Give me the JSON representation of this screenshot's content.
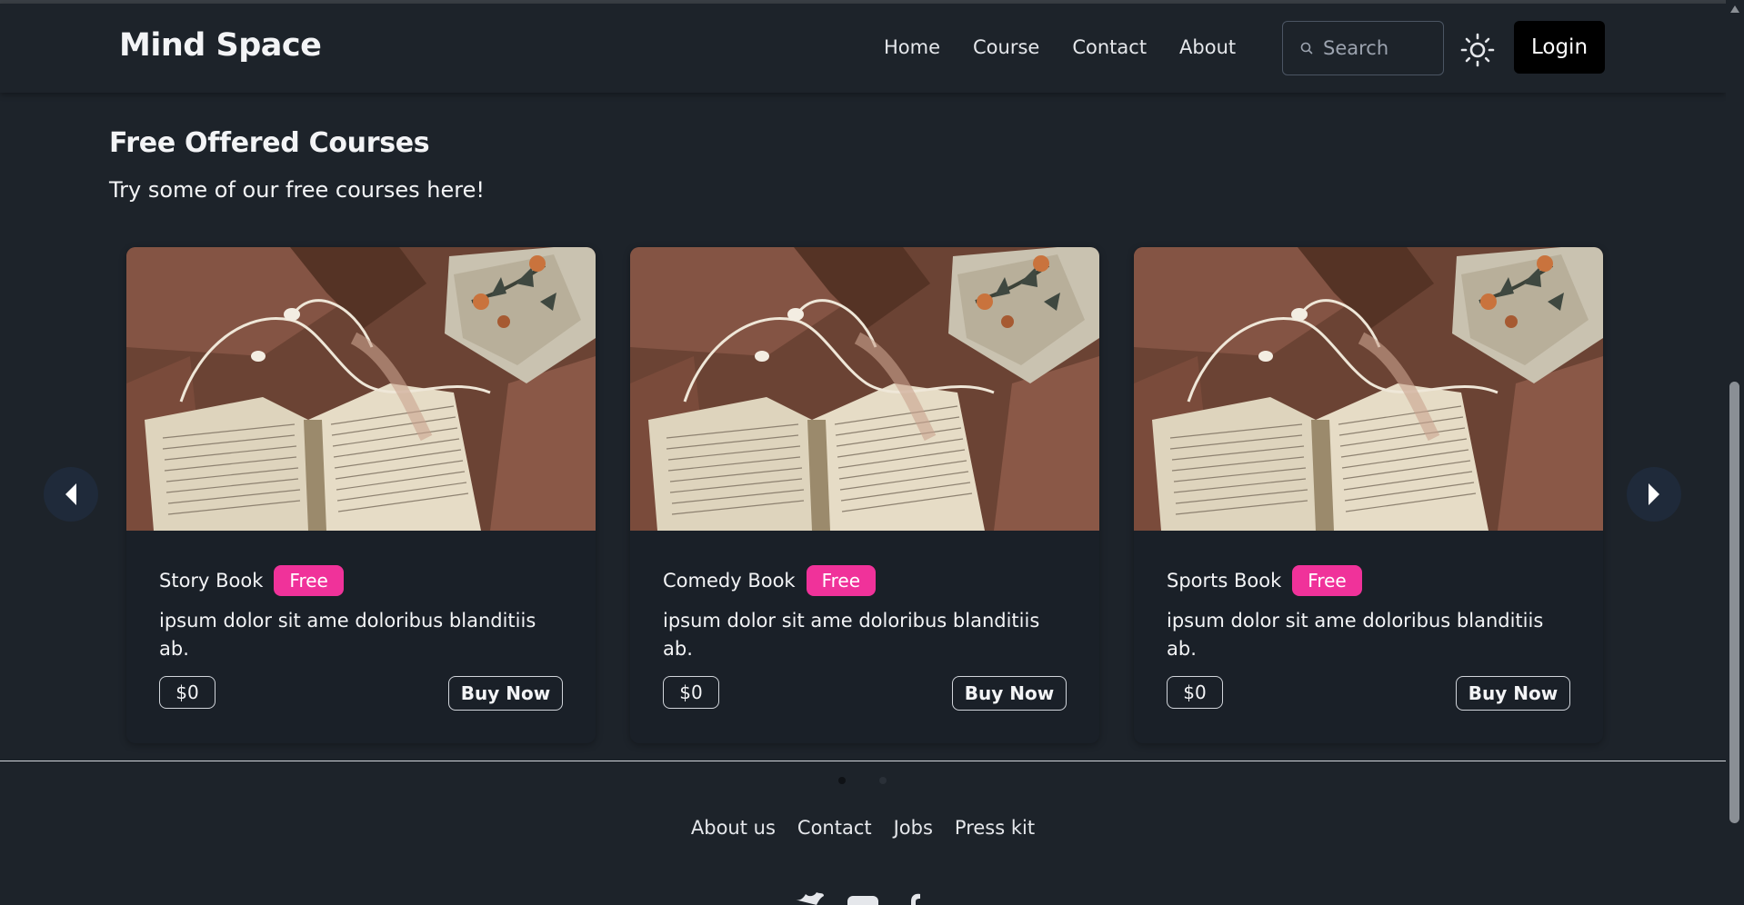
{
  "navbar": {
    "brand": "Mind Space",
    "links": [
      "Home",
      "Course",
      "Contact",
      "About"
    ],
    "search_placeholder": "Search",
    "login_label": "Login"
  },
  "section": {
    "title": "Free Offered Courses",
    "subtitle": "Try some of our free courses here!"
  },
  "cards": [
    {
      "name": "Story Book",
      "badge": "Free",
      "description": "ipsum dolor sit ame doloribus blanditiis ab.",
      "price": "$0",
      "button": "Buy Now"
    },
    {
      "name": "Comedy Book",
      "badge": "Free",
      "description": "ipsum dolor sit ame doloribus blanditiis ab.",
      "price": "$0",
      "button": "Buy Now"
    },
    {
      "name": "Sports Book",
      "badge": "Free",
      "description": "ipsum dolor sit ame doloribus blanditiis ab.",
      "price": "$0",
      "button": "Buy Now"
    }
  ],
  "carousel": {
    "active_dot": 0,
    "dot_count": 2
  },
  "footer": {
    "links": [
      "About us",
      "Contact",
      "Jobs",
      "Press kit"
    ],
    "social_icons": [
      "twitter-icon",
      "youtube-icon",
      "facebook-icon"
    ]
  },
  "colors": {
    "background": "#1d232a",
    "badge": "#f0329a",
    "login_bg": "#000000",
    "card_bg": "#1a2028"
  }
}
